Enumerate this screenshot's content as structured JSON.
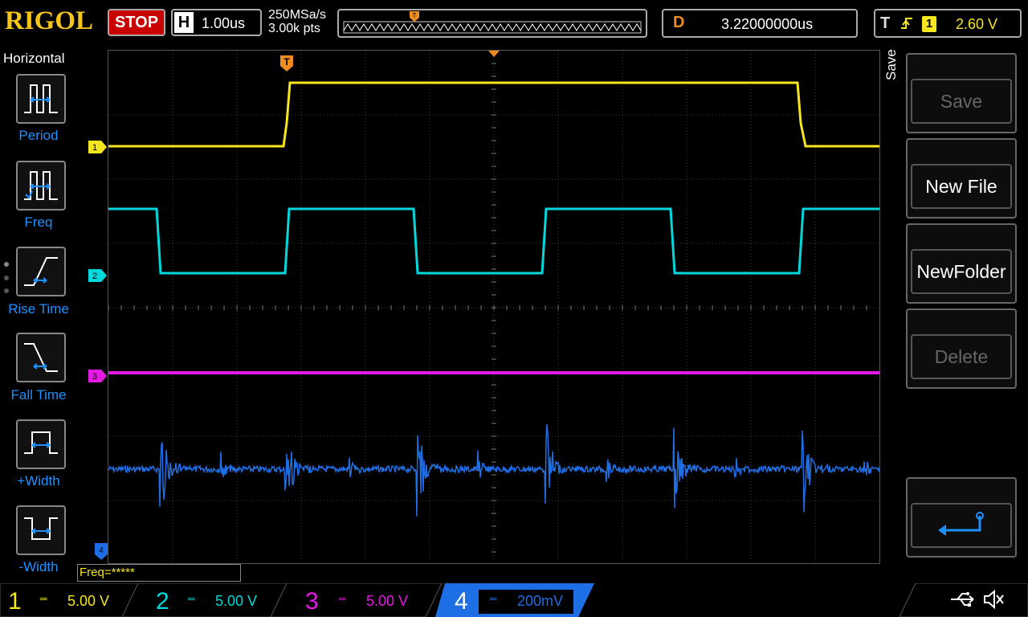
{
  "brand": "RIGOL",
  "run_state": "STOP",
  "horizontal": {
    "label": "H",
    "timebase": "1.00us",
    "sample_rate": "250MSa/s",
    "memory_depth": "3.00k pts"
  },
  "delay": {
    "label": "D",
    "value": "3.22000000us"
  },
  "trigger": {
    "label": "T",
    "source": "1",
    "level": "2.60 V"
  },
  "trigger_marker": "T",
  "left_menu": {
    "title": "Horizontal",
    "items": [
      {
        "label": "Period",
        "icon": "period-icon"
      },
      {
        "label": "Freq",
        "icon": "frequency-icon"
      },
      {
        "label": "Rise Time",
        "icon": "rise-time-icon"
      },
      {
        "label": "Fall Time",
        "icon": "fall-time-icon"
      },
      {
        "label": "+Width",
        "icon": "positive-width-icon"
      },
      {
        "label": "-Width",
        "icon": "negative-width-icon"
      }
    ]
  },
  "right_menu": {
    "title": "Save",
    "items": [
      {
        "label": "Save",
        "enabled": false
      },
      {
        "label": "New File",
        "enabled": true
      },
      {
        "label": "NewFolder",
        "enabled": true
      },
      {
        "label": "Delete",
        "enabled": false
      },
      {
        "label": "",
        "icon": "enter-return-icon",
        "enabled": true
      }
    ]
  },
  "freq_readout": "Freq=*****",
  "channels": [
    {
      "num": "1",
      "scale": "5.00 V",
      "color": "#f5e61e"
    },
    {
      "num": "2",
      "scale": "5.00 V",
      "color": "#00d8dc"
    },
    {
      "num": "3",
      "scale": "5.00 V",
      "color": "#e619e6"
    },
    {
      "num": "4",
      "scale": "200mV",
      "color": "#1e6ee6"
    }
  ],
  "status_icons": [
    "usb-icon",
    "speaker-muted-icon"
  ]
}
